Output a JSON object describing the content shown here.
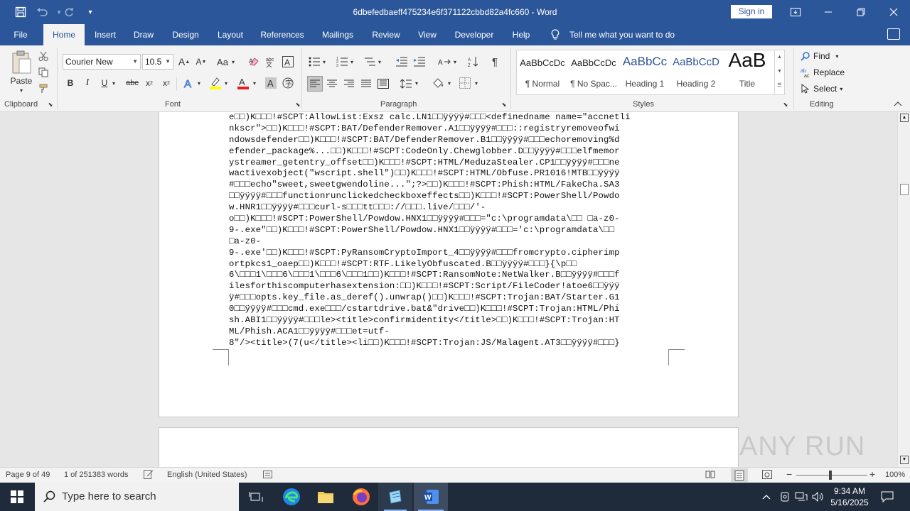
{
  "window": {
    "title": "6dbefedbaeff475234e6f371122cbbd82a4fc660  -  Word",
    "sign_in": "Sign in"
  },
  "tabs": [
    "File",
    "Home",
    "Insert",
    "Draw",
    "Design",
    "Layout",
    "References",
    "Mailings",
    "Review",
    "View",
    "Developer",
    "Help"
  ],
  "tell_me": "Tell me what you want to do",
  "ribbon": {
    "clipboard": {
      "paste": "Paste",
      "label": "Clipboard"
    },
    "font": {
      "name": "Courier New",
      "size": "10.5",
      "label": "Font",
      "aa": "Aa"
    },
    "paragraph": {
      "label": "Paragraph"
    },
    "styles": {
      "label": "Styles",
      "items": [
        {
          "preview": "AaBbCcDc",
          "name": "¶ Normal"
        },
        {
          "preview": "AaBbCcDc",
          "name": "¶ No Spac..."
        },
        {
          "preview": "AaBbCc",
          "name": "Heading 1"
        },
        {
          "preview": "AaBbCcD",
          "name": "Heading 2"
        },
        {
          "preview": "AaB",
          "name": "Title"
        }
      ]
    },
    "editing": {
      "find": "Find",
      "replace": "Replace",
      "select": "Select",
      "label": "Editing"
    }
  },
  "document": {
    "lines": [
      "e□□)K□□□!#SCPT:AllowList:Exsz calc.LN1□□ÿÿÿÿ#□□□<definedname name=\"accnetli",
      "nkscr\">□□)K□□□!#SCPT:BAT/DefenderRemover.A1□□ÿÿÿÿ#□□□::registryremoveofwi",
      "ndowsdefender□□)K□□□!#SCPT:BAT/DefenderRemover.B1□□ÿÿÿÿ#□□□echoremoving%d",
      "efender_package%...□□)K□□□!#SCPT:CodeOnly.Chewglobber.D□□ÿÿÿÿ#□□□elfmemor",
      "ystreamer_getentry_offset□□)K□□□!#SCPT:HTML/MeduzaStealer.CP1□□ÿÿÿÿ#□□□ne",
      "wactivexobject(\"wscript.shell\")□□)K□□□!#SCPT:HTML/Obfuse.PR1016!MTB□□ÿÿÿÿ",
      "#□□□echo\"sweet,sweetgwendoline...\";?>□□)K□□□!#SCPT:Phish:HTML/FakeCha.SA3",
      "□□ÿÿÿÿ#□□□functionrunclickedcheckboxeffects□□)K□□□!#SCPT:PowerShell/Powdo",
      "w.HNR1□□ÿÿÿÿ#□□□curl-s□□□tt□□□://□□□.live/□□□/'-",
      "o□□)K□□□!#SCPT:PowerShell/Powdow.HNX1□□ÿÿÿÿ#□□□=\"c:\\programdata\\□□ □a-z0-",
      "9-.exe\"□□)K□□□!#SCPT:PowerShell/Powdow.HNX1□□ÿÿÿÿ#□□□='c:\\programdata\\□□",
      "□a-z0-",
      "9-.exe'□□)K□□□!#SCPT:PyRansomCryptoImport_4□□ÿÿÿÿ#□□□fromcrypto.cipherimp",
      "ortpkcs1_oaep□□)K□□□!#SCPT:RTF.LikelyObfuscated.B□□ÿÿÿÿ#□□□}{\\p□□",
      "6\\□□□1\\□□□6\\□□□1\\□□□6\\□□□1□□)K□□□!#SCPT:RansomNote:NetWalker.B□□ÿÿÿÿ#□□□f",
      "ilesforthiscomputerhasextension:□□)K□□□!#SCPT:Script/FileCoder!atoe6□□ÿÿÿ",
      "ÿ#□□□opts.key_file.as_deref().unwrap()□□)K□□□!#SCPT:Trojan:BAT/Starter.G1",
      "0□□ÿÿÿÿ#□□□cmd.exe□□□/cstartdrive.bat&\"drive□□)K□□□!#SCPT:Trojan:HTML/Phi",
      "sh.ABI1□□ÿÿÿÿ#□□□le><title>confirmidentity</title>□□)K□□□!#SCPT:Trojan:HT",
      "ML/Phish.ACA1□□ÿÿÿÿ#□□□et=utf-",
      "8\"/><title>(7(u</title><li□□)K□□□!#SCPT:Trojan:JS/Malagent.AT3□□ÿÿÿÿ#□□□}"
    ]
  },
  "status": {
    "page": "Page 9 of 49",
    "words": "1 of 251383 words",
    "language": "English (United States)",
    "zoom": "100%"
  },
  "taskbar": {
    "search_placeholder": "Type here to search",
    "time": "9:34 AM",
    "date": "5/16/2025"
  },
  "watermark": "ANY RUN"
}
